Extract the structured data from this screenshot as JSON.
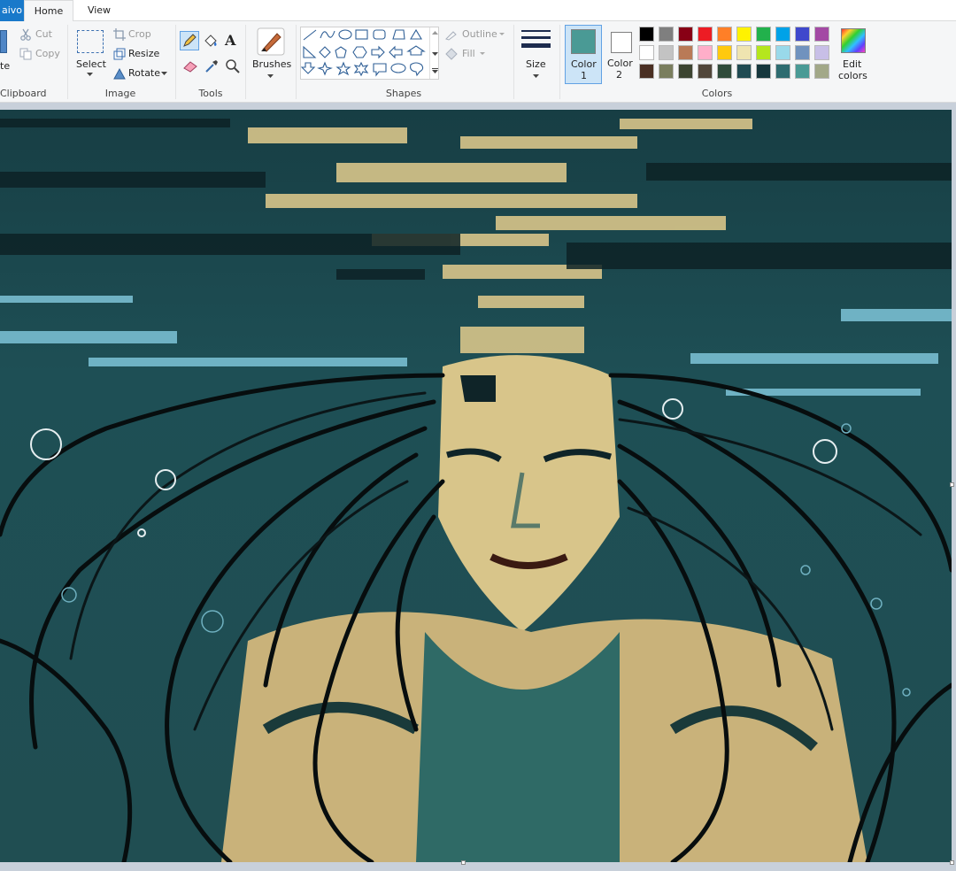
{
  "tabs": {
    "file": "aivo",
    "home": "Home",
    "view": "View"
  },
  "clipboard": {
    "paste": "te",
    "cut": "Cut",
    "copy": "Copy",
    "label": "Clipboard"
  },
  "image": {
    "select": "Select",
    "crop": "Crop",
    "resize": "Resize",
    "rotate": "Rotate",
    "label": "Image"
  },
  "tools": {
    "label": "Tools",
    "text_tool": "A"
  },
  "brushes": {
    "label": "Brushes"
  },
  "shapes": {
    "outline": "Outline",
    "fill": "Fill",
    "label": "Shapes"
  },
  "size": {
    "label": "Size"
  },
  "color1": {
    "line1": "Color",
    "line2": "1",
    "value": "#4a9a95"
  },
  "color2": {
    "line1": "Color",
    "line2": "2",
    "value": "#ffffff"
  },
  "colors": {
    "label": "Colors",
    "row1": [
      "#000000",
      "#7f7f7f",
      "#880015",
      "#ed1c24",
      "#ff7f27",
      "#fff200",
      "#22b14c",
      "#00a2e8",
      "#3f48cc",
      "#a349a4"
    ],
    "row2": [
      "#ffffff",
      "#c3c3c3",
      "#b97a57",
      "#ffaec9",
      "#ffc90e",
      "#efe4b0",
      "#b5e61d",
      "#99d9ea",
      "#7092be",
      "#c8bfe7"
    ],
    "row3": [
      "#4a2f23",
      "#7a7e5e",
      "#3c4431",
      "#51463a",
      "#2f4b3a",
      "#1f4a52",
      "#16373d",
      "#2e6c70",
      "#4a9a95",
      "#a2a888"
    ]
  },
  "edit_colors": {
    "line1": "Edit",
    "line2": "colors"
  }
}
